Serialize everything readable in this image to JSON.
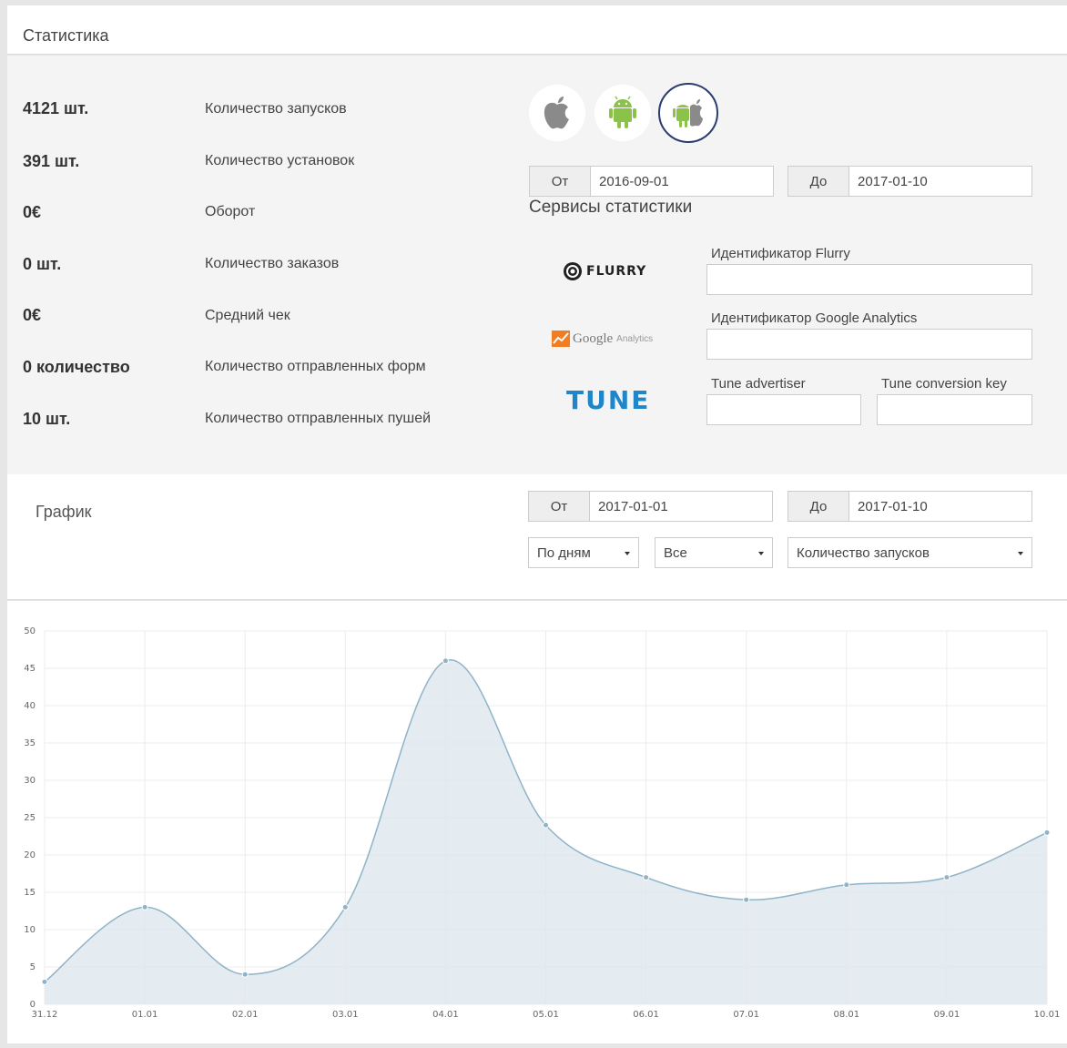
{
  "stats": {
    "title": "Статистика",
    "metrics": [
      {
        "value": "4121 шт.",
        "label": "Количество запусков"
      },
      {
        "value": "391 шт.",
        "label": "Количество установок"
      },
      {
        "value": "0€",
        "label": "Оборот"
      },
      {
        "value": "0 шт.",
        "label": "Количество заказов"
      },
      {
        "value": "0€",
        "label": "Средний чек"
      },
      {
        "value": "0 количество",
        "label": "Количество отправленных форм"
      },
      {
        "value": "10 шт.",
        "label": "Количество отправленных пушей"
      }
    ],
    "platforms": [
      {
        "name": "apple-icon",
        "active": false
      },
      {
        "name": "android-icon",
        "active": false
      },
      {
        "name": "android-apple-icon",
        "active": true
      }
    ],
    "date_from_label": "От",
    "date_from": "2016-09-01",
    "date_to_label": "До",
    "date_to": "2017-01-10",
    "services_title": "Сервисы статистики",
    "flurry_logo_text": "FLURRY",
    "flurry_label": "Идентификатор Flurry",
    "flurry_value": "",
    "ga_logo_text": "Google",
    "ga_logo_sub": "Analytics",
    "ga_label": "Идентификатор Google Analytics",
    "ga_value": "",
    "tune_logo_text": "TUNE",
    "tune_advertiser_label": "Tune advertiser",
    "tune_advertiser_value": "",
    "tune_key_label": "Tune conversion key",
    "tune_key_value": ""
  },
  "graph": {
    "title": "График",
    "date_from_label": "От",
    "date_from": "2017-01-01",
    "date_to_label": "До",
    "date_to": "2017-01-10",
    "period_select": "По дням",
    "platform_select": "Все",
    "metric_select": "Количество запусков"
  },
  "colors": {
    "accent_border": "#2b3c6e",
    "android_green": "#8bc34a",
    "apple_grey": "#8a8a8a",
    "tune_blue": "#1f86c9",
    "line": "#8fb3c8",
    "area": "#dfe8ee"
  },
  "chart_data": {
    "type": "area",
    "categories": [
      "31.12",
      "01.01",
      "02.01",
      "03.01",
      "04.01",
      "05.01",
      "06.01",
      "07.01",
      "08.01",
      "09.01",
      "10.01"
    ],
    "values": [
      3,
      13,
      4,
      13,
      46,
      24,
      17,
      14,
      16,
      17,
      23
    ],
    "ylim": [
      0,
      50
    ],
    "yticks": [
      0,
      5,
      10,
      15,
      20,
      25,
      30,
      35,
      40,
      45,
      50
    ],
    "grid": true,
    "title": "",
    "xlabel": "",
    "ylabel": ""
  }
}
